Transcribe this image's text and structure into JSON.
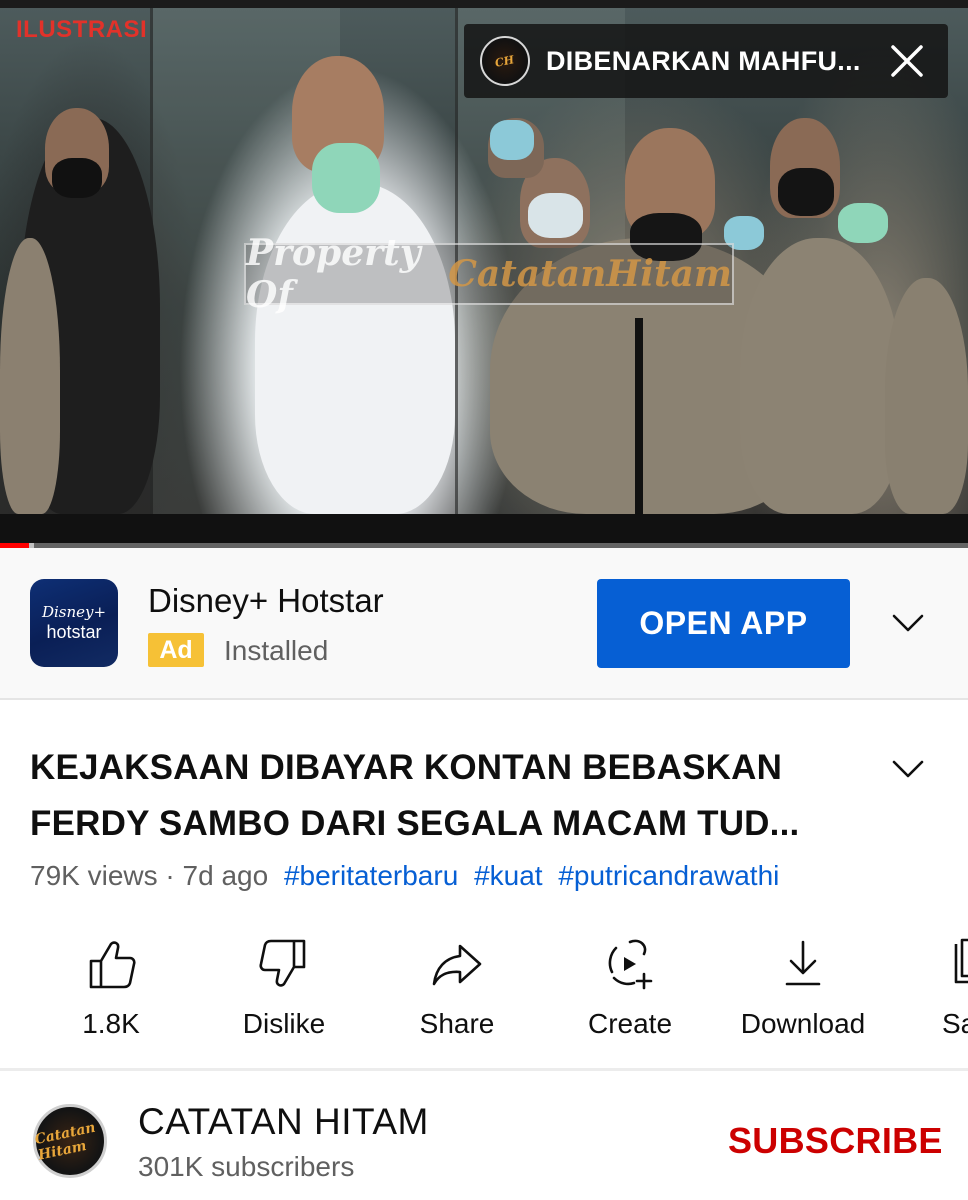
{
  "video": {
    "overlay_label": "ILUSTRASI",
    "watermark_text_part1": "Property Of",
    "watermark_text_part2": "CatatanHitam",
    "progress_fraction": 0.03,
    "buffer_fraction": 0.005,
    "mini_card": {
      "title": "DIBENARKAN MAHFU...",
      "close_icon": "close-icon"
    },
    "colors": {
      "overlay_label": "#e2322a",
      "progress": "#ff0000"
    }
  },
  "ad": {
    "app_icon_line1": "Disney+",
    "app_icon_line2": "hotstar",
    "app_name": "Disney+ Hotstar",
    "badge": "Ad",
    "status": "Installed",
    "cta_label": "OPEN APP",
    "expand_icon": "chevron-down-icon",
    "colors": {
      "cta": "#065fd4",
      "badge": "#f6c136"
    }
  },
  "video_info": {
    "title": "KEJAKSAAN DIBAYAR KONTAN BEBASKAN FERDY SAMBO DARI SEGALA MACAM TUD...",
    "views": "79K views",
    "separator": "·",
    "age": "7d ago",
    "hashtags": [
      "#beritaterbaru",
      "#kuat",
      "#putricandrawathi"
    ],
    "expand_icon": "chevron-down-icon"
  },
  "actions": [
    {
      "icon": "thumbs-up-icon",
      "label": "1.8K"
    },
    {
      "icon": "thumbs-down-icon",
      "label": "Dislike"
    },
    {
      "icon": "share-icon",
      "label": "Share"
    },
    {
      "icon": "create-icon",
      "label": "Create"
    },
    {
      "icon": "download-icon",
      "label": "Download"
    },
    {
      "icon": "save-icon",
      "label": "Sa"
    }
  ],
  "channel": {
    "avatar_text": "Catatan Hitam",
    "name": "CATATAN HITAM",
    "subscribers": "301K subscribers",
    "subscribe_label": "SUBSCRIBE",
    "colors": {
      "subscribe": "#cc0000"
    }
  }
}
